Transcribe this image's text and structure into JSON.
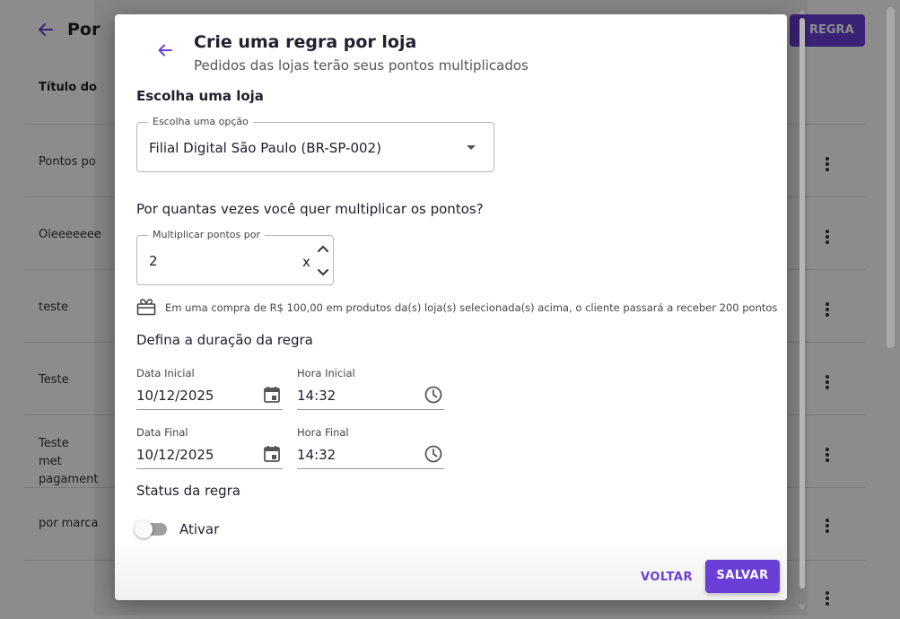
{
  "background": {
    "title": "Por",
    "primary_button": "REGRA",
    "column_header": "Título do",
    "rows": [
      {
        "label": "Pontos po"
      },
      {
        "label": "Oieeeeeee"
      },
      {
        "label": "teste"
      },
      {
        "label": "Teste"
      },
      {
        "label": "Teste met pagament"
      },
      {
        "label": "por marca"
      },
      {
        "label": ""
      }
    ]
  },
  "modal": {
    "title": "Crie uma regra por loja",
    "subtitle": "Pedidos das lojas terão seus pontos multiplicados",
    "store_section": {
      "heading": "Escolha uma loja",
      "select_label": "Escolha uma opção",
      "select_value": "Filial Digital São Paulo (BR-SP-002)"
    },
    "multiplier_section": {
      "heading": "Por quantas vezes você quer multiplicar os pontos?",
      "field_label": "Multiplicar pontos por",
      "value": "2",
      "suffix": "x"
    },
    "info": {
      "text": "Em uma compra de R$ 100,00 em produtos da(s) loja(s) selecionada(s) acima, o cliente passará a receber 200 pontos"
    },
    "duration_section": {
      "heading": "Defina a duração da regra",
      "start_date_label": "Data Inicial",
      "start_date_value": "10/12/2025",
      "start_time_label": "Hora Inicial",
      "start_time_value": "14:32",
      "end_date_label": "Data Final",
      "end_date_value": "10/12/2025",
      "end_time_label": "Hora Final",
      "end_time_value": "14:32"
    },
    "status_section": {
      "heading": "Status da regra",
      "toggle_label": "Ativar",
      "toggle_on": false
    },
    "footer": {
      "back_label": "VOLTAR",
      "save_label": "SALVAR"
    }
  },
  "colors": {
    "accent": "#6a3fd8",
    "text": "#22202e",
    "backdrop": "rgba(0,0,0,0.45)"
  }
}
